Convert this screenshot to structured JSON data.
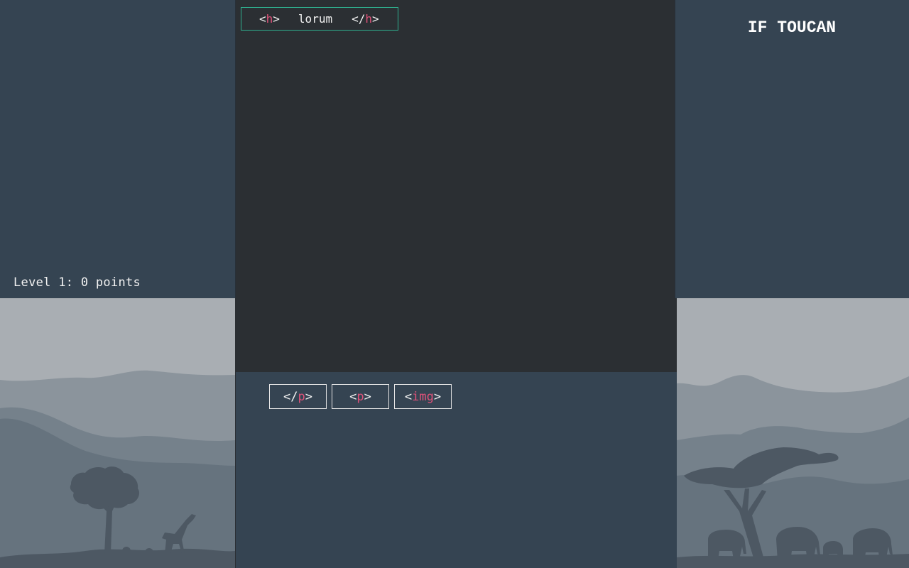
{
  "score": {
    "text": "Level 1: 0 points"
  },
  "title": "IF TOUCAN",
  "code_line": {
    "open_lt": "<",
    "open_name": "h",
    "open_gt": ">",
    "content": "lorum",
    "close_lt": "</",
    "close_name": "h",
    "close_gt": ">"
  },
  "palette": [
    {
      "lt": "</",
      "name": "p",
      "gt": ">"
    },
    {
      "lt": "<",
      "name": "p",
      "gt": ">"
    },
    {
      "lt": "<",
      "name": "img",
      "gt": ">"
    }
  ],
  "colors": {
    "panel": "#354452",
    "editor": "#2b2f33",
    "tag_name": "#e0527a",
    "active_border": "#2fb08f",
    "sky": "#a9aeb3"
  },
  "icons": {
    "left_scene": "savanna-tree-giraffe",
    "right_scene": "acacia-tree-elephants"
  }
}
